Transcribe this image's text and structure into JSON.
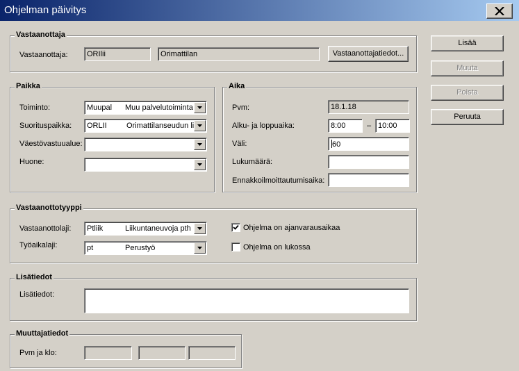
{
  "window": {
    "title": "Ohjelman päivitys",
    "close_icon": "close-icon"
  },
  "buttons": {
    "add": "Lisää",
    "modify": "Muuta",
    "delete": "Poista",
    "cancel": "Peruuta"
  },
  "receiver": {
    "legend": "Vastaanottaja",
    "label": "Vastaanottaja:",
    "code": "ORIlii",
    "name": "Orimattilan",
    "details_button": "Vastaanottajatiedot..."
  },
  "place": {
    "legend": "Paikka",
    "activity": {
      "label": "Toiminto:",
      "code": "Muupal",
      "text": "Muu palvelutoiminta"
    },
    "venue": {
      "label": "Suorituspaikka:",
      "code": "ORLII",
      "text": "Orimattilanseudun lii"
    },
    "population": {
      "label": "Väestövastuualue:",
      "code": "",
      "text": ""
    },
    "room": {
      "label": "Huone:",
      "code": "",
      "text": ""
    }
  },
  "time": {
    "legend": "Aika",
    "date": {
      "label": "Pvm:",
      "value": "18.1.18"
    },
    "start_end": {
      "label": "Alku- ja loppuaika:",
      "start": "8:00",
      "dash": "–",
      "end": "10:00"
    },
    "interval": {
      "label": "Väli:",
      "value": "60"
    },
    "count": {
      "label": "Lukumäärä:",
      "value": ""
    },
    "advance": {
      "label": "Ennakkoilmoittautumisaika:",
      "value": ""
    }
  },
  "reception_type": {
    "legend": "Vastaanottotyyppi",
    "kind": {
      "label": "Vastaanottolaji:",
      "code": "Ptliik",
      "text": "Liikuntaneuvoja pth"
    },
    "worktime": {
      "label": "Työaikalaji:",
      "code": "pt",
      "text": "Perustyö"
    },
    "booking": {
      "label": "Ohjelma on ajanvarausaikaa",
      "checked": true
    },
    "locked": {
      "label": "Ohjelma on lukossa",
      "checked": false
    }
  },
  "extra": {
    "legend": "Lisätiedot",
    "label": "Lisätiedot:",
    "value": ""
  },
  "modifier": {
    "legend": "Muuttajatiedot",
    "label": "Pvm ja klo:",
    "v1": "",
    "v2": "",
    "v3": ""
  },
  "colors": {
    "titlebar_start": "#0a246a",
    "titlebar_end": "#a6caf0",
    "face": "#d4d0c8"
  }
}
